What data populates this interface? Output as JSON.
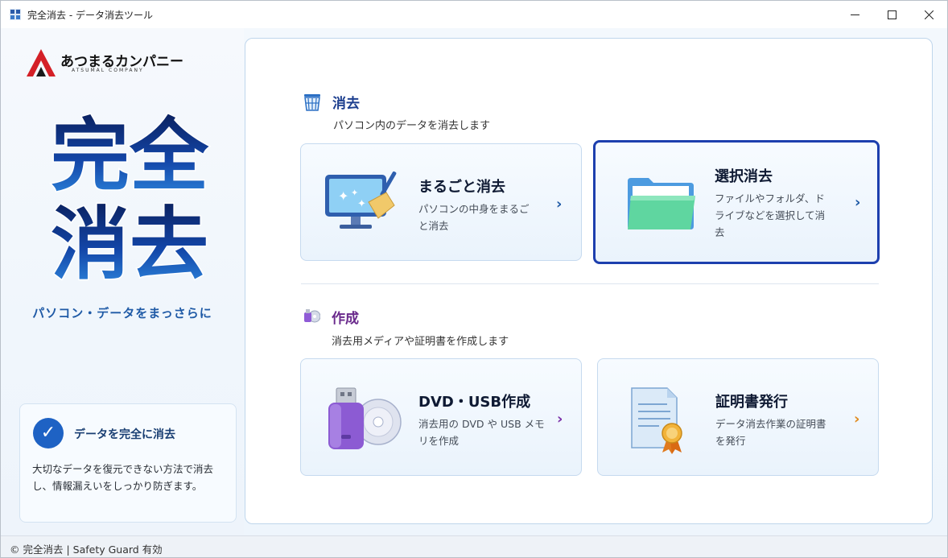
{
  "window": {
    "title": "完全消去 - データ消去ツール"
  },
  "sidebar": {
    "logo_text": "あつまるカンパニー",
    "logo_sub": "ATSUMAL COMPANY",
    "big_title_line1": "完全",
    "big_title_line2": "消去",
    "tagline": "パソコン・データをまっさらに",
    "info": {
      "title": "データを完全に消去",
      "body": "大切なデータを復元できない方法で消去し、情報漏えいをしっかり防ぎます。"
    }
  },
  "sections": {
    "erase": {
      "title": "消去",
      "description": "パソコン内のデータを消去します",
      "title_color": "#1d3f8f",
      "cards": [
        {
          "title": "まるごと消去",
          "desc_line1": "パソコンの中身をまるご",
          "desc_line2": "と消去",
          "icon": "monitor-broom-icon",
          "chevron_color": "#1f5aa6"
        },
        {
          "title": "選択消去",
          "desc_line1": "ファイルやフォルダ、ド",
          "desc_line2": "ライブなどを選択して消",
          "desc_line3": "去",
          "icon": "folder-icon",
          "chevron_color": "#1f5aa6",
          "selected": true
        }
      ]
    },
    "create": {
      "title": "作成",
      "description": "消去用メディアや証明書を作成します",
      "title_color": "#6a2a8c",
      "cards": [
        {
          "title": "DVD・USB作成",
          "desc_line1": "消去用の DVD や USB メモ",
          "desc_line2": "リを作成",
          "icon": "usb-dvd-icon",
          "chevron_color": "#7a2fa8"
        },
        {
          "title": "証明書発行",
          "desc_line1": "データ消去作業の証明書",
          "desc_line2": "を発行",
          "icon": "certificate-icon",
          "chevron_color": "#e08a1e"
        }
      ]
    }
  },
  "status": {
    "text": "© 完全消去 | Safety Guard 有効"
  },
  "colors": {
    "accent": "#1e62c4",
    "selected_border": "#1d3fae"
  }
}
